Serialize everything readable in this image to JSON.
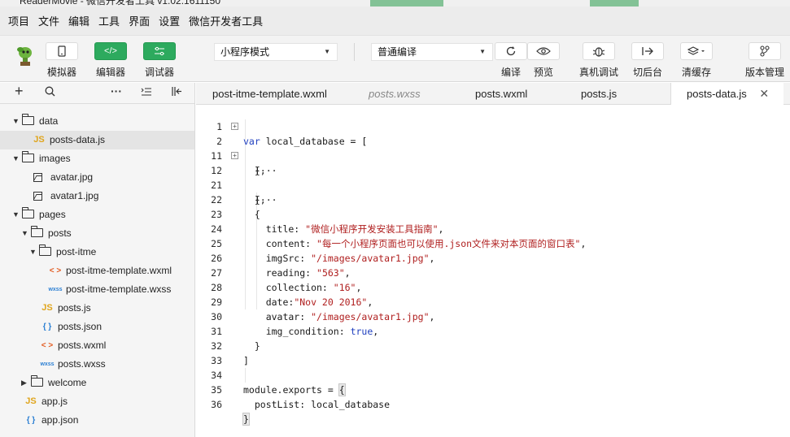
{
  "title_bar": "ReaderMovie - 微信开发者工具 v1.02.1611150",
  "menu": [
    "项目",
    "文件",
    "编辑",
    "工具",
    "界面",
    "设置",
    "微信开发者工具"
  ],
  "toolbar": {
    "simulator": "模拟器",
    "editor": "编辑器",
    "debugger": "调试器",
    "mode_select": "小程序模式",
    "compile_select": "普通编译",
    "compile": "编译",
    "preview": "预览",
    "remote_debug": "真机调试",
    "background": "切后台",
    "clear_cache": "清缓存",
    "version": "版本管理"
  },
  "tree": [
    {
      "label": "data",
      "type": "folder",
      "open": true
    },
    {
      "label": "posts-data.js",
      "type": "js"
    },
    {
      "label": "images",
      "type": "folder",
      "open": true
    },
    {
      "label": "avatar.jpg",
      "type": "img"
    },
    {
      "label": "avatar1.jpg",
      "type": "img"
    },
    {
      "label": "pages",
      "type": "folder",
      "open": true
    },
    {
      "label": "posts",
      "type": "folder",
      "open": true
    },
    {
      "label": "post-itme",
      "type": "folder",
      "open": true
    },
    {
      "label": "post-itme-template.wxml",
      "type": "wxml"
    },
    {
      "label": "post-itme-template.wxss",
      "type": "wxss"
    },
    {
      "label": "posts.js",
      "type": "js"
    },
    {
      "label": "posts.json",
      "type": "json"
    },
    {
      "label": "posts.wxml",
      "type": "wxml"
    },
    {
      "label": "posts.wxss",
      "type": "wxss"
    },
    {
      "label": "welcome",
      "type": "folder",
      "open": false
    },
    {
      "label": "app.js",
      "type": "js"
    },
    {
      "label": "app.json",
      "type": "json"
    }
  ],
  "file_icons": {
    "js": "JS",
    "json": "{ }",
    "wxml": "< >",
    "wxss": "wxss"
  },
  "tabs": [
    {
      "label": "post-itme-template.wxml"
    },
    {
      "label": "posts.wxss"
    },
    {
      "label": "posts.wxml"
    },
    {
      "label": "posts.js"
    },
    {
      "label": "posts-data.js"
    }
  ],
  "code": {
    "line_numbers": [
      "1",
      "2",
      "11",
      "12",
      "21",
      "22",
      "23",
      "24",
      "25",
      "26",
      "27",
      "28",
      "29",
      "30",
      "31",
      "32",
      "33",
      "34",
      "35",
      "36"
    ],
    "l1_kw": "var",
    "l1_rest": " local_database = [",
    "l2": "  {···",
    "l11": "  },",
    "l12": "  {···",
    "l21": "  },",
    "l22": "  {",
    "l23_key": "    title: ",
    "l23_val": "\"微信小程序开发安装工具指南\"",
    "l23_end": ",",
    "l24_key": "    content: ",
    "l24_val": "\"每一个小程序页面也可以使用.json文件来对本页面的窗口表\"",
    "l24_end": ",",
    "l25_key": "    imgSrc: ",
    "l25_val": "\"/images/avatar1.jpg\"",
    "l25_end": ",",
    "l26_key": "    reading: ",
    "l26_val": "\"563\"",
    "l26_end": ",",
    "l27_key": "    collection: ",
    "l27_val": "\"16\"",
    "l27_end": ",",
    "l28_key": "    date:",
    "l28_val": "\"Nov 20 2016\"",
    "l28_end": ",",
    "l29_key": "    avatar: ",
    "l29_val": "\"/images/avatar1.jpg\"",
    "l29_end": ",",
    "l30_key": "    img_condition: ",
    "l30_val": "true",
    "l30_end": ",",
    "l31": "  }",
    "l32": "]",
    "l33": "",
    "l34_rest": "module.exports = ",
    "l34_brace": "{",
    "l35": "  postList: local_database",
    "l36": "}"
  },
  "colors": {
    "accent_green": "#2daa5e",
    "keyword": "#1f3fbf",
    "string": "#b02020"
  }
}
